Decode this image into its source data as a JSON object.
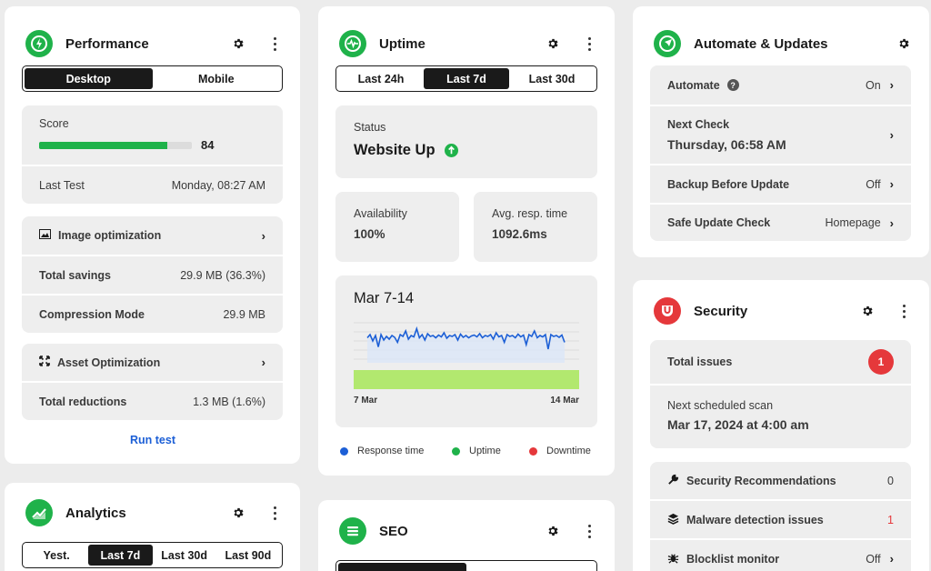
{
  "performance": {
    "title": "Performance",
    "tabs": [
      "Desktop",
      "Mobile"
    ],
    "active_tab": 0,
    "score_label": "Score",
    "score_value": "84",
    "score_fraction": 0.84,
    "last_test_label": "Last Test",
    "last_test_value": "Monday, 08:27 AM",
    "image_opt_label": "Image optimization",
    "total_savings_label": "Total savings",
    "total_savings_value": "29.9 MB (36.3%)",
    "compression_label": "Compression Mode",
    "compression_value": "29.9 MB",
    "asset_opt_label": "Asset Optimization",
    "total_reductions_label": "Total reductions",
    "total_reductions_value": "1.3 MB (1.6%)",
    "run_test": "Run test"
  },
  "analytics": {
    "title": "Analytics",
    "tabs": [
      "Yest.",
      "Last 7d",
      "Last 30d",
      "Last 90d"
    ],
    "active_tab": 1
  },
  "uptime": {
    "title": "Uptime",
    "tabs": [
      "Last 24h",
      "Last 7d",
      "Last 30d"
    ],
    "active_tab": 1,
    "status_label": "Status",
    "status_value": "Website Up",
    "availability_label": "Availability",
    "availability_value": "100%",
    "resp_label": "Avg. resp. time",
    "resp_value": "1092.6ms",
    "chart_title": "Mar 7-14",
    "x_start": "7 Mar",
    "x_end": "14 Mar",
    "legend": [
      {
        "label": "Response time",
        "color": "#1c5fd6"
      },
      {
        "label": "Uptime",
        "color": "#1fb24a"
      },
      {
        "label": "Downtime",
        "color": "#e5383b"
      }
    ]
  },
  "chart_data": {
    "type": "line",
    "title": "Mar 7-14",
    "x": [
      "7 Mar",
      "14 Mar"
    ],
    "series": [
      {
        "values": [
          0.55,
          0.62,
          0.48,
          0.6,
          0.35,
          0.62,
          0.5,
          0.58,
          0.52,
          0.6,
          0.56,
          0.45,
          0.62,
          0.58,
          0.7,
          0.52,
          0.6,
          0.57,
          0.75,
          0.55,
          0.62,
          0.5,
          0.64,
          0.58,
          0.6,
          0.55,
          0.61,
          0.57,
          0.66,
          0.54,
          0.6,
          0.58,
          0.62,
          0.5,
          0.63,
          0.56,
          0.6,
          0.55,
          0.59,
          0.61,
          0.57,
          0.64,
          0.55,
          0.6,
          0.58,
          0.62,
          0.52,
          0.66,
          0.57,
          0.6,
          0.45,
          0.62,
          0.58,
          0.6,
          0.55,
          0.63,
          0.57,
          0.61,
          0.4,
          0.62,
          0.58,
          0.7,
          0.55,
          0.6,
          0.57,
          0.62,
          0.3,
          0.62,
          0.58,
          0.6,
          0.56,
          0.61,
          0.45
        ]
      }
    ],
    "uptime_fraction": 1.0
  },
  "automate": {
    "title": "Automate & Updates",
    "automate_label": "Automate",
    "automate_value": "On",
    "next_check_label": "Next Check",
    "next_check_value": "Thursday, 06:58 AM",
    "backup_label": "Backup Before Update",
    "backup_value": "Off",
    "safe_label": "Safe Update Check",
    "safe_value": "Homepage"
  },
  "security": {
    "title": "Security",
    "total_issues_label": "Total issues",
    "total_issues_value": "1",
    "next_scan_label": "Next scheduled scan",
    "next_scan_value": "Mar 17, 2024 at 4:00 am",
    "recs_label": "Security Recommendations",
    "recs_value": "0",
    "malware_label": "Malware detection issues",
    "malware_value": "1",
    "blocklist_label": "Blocklist monitor",
    "blocklist_value": "Off"
  },
  "seo": {
    "title": "SEO"
  }
}
